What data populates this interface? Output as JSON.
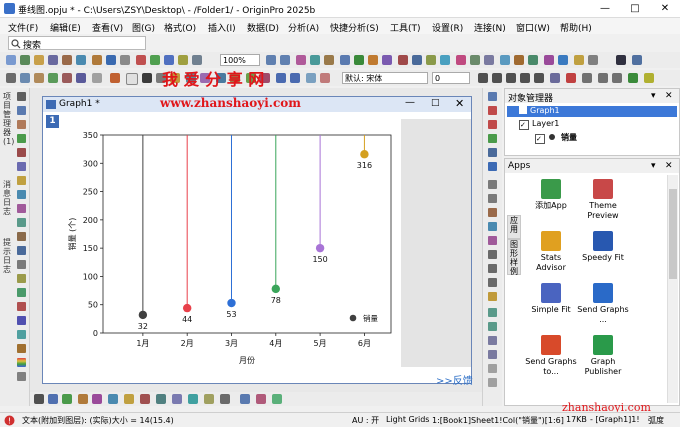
{
  "window": {
    "title": "垂线图.opju * - C:\\Users\\ZSY\\Desktop\\ - /Folder1/ - OriginPro 2025b"
  },
  "menu": [
    "文件(F)",
    "编辑(E)",
    "查看(V)",
    "图(G)",
    "格式(O)",
    "插入(I)",
    "数据(D)",
    "分析(A)",
    "快捷分析(S)",
    "工具(T)",
    "设置(R)",
    "连接(N)",
    "窗口(W)",
    "帮助(H)"
  ],
  "search": {
    "label": "搜索"
  },
  "toolbar": {
    "zoom": "100%",
    "font": "默认: 宋体",
    "size": "0"
  },
  "left_sidebar": {
    "tabs": [
      "项目管理器(1)",
      "消息日志",
      "提示日志"
    ]
  },
  "graph_window": {
    "title": "Graph1 *",
    "layer_button": "1",
    "feedback": ">>反馈"
  },
  "watermark": {
    "top": "我 爱 分 享 网",
    "url": "www.zhanshaoyi.com",
    "corner": "zhanshaoyi.com"
  },
  "chart_data": {
    "type": "lollipop",
    "categories": [
      "1月",
      "2月",
      "3月",
      "4月",
      "5月",
      "6月"
    ],
    "values": [
      32,
      44,
      53,
      78,
      150,
      316
    ],
    "colors": [
      "#404040",
      "#e8404a",
      "#2d6fd6",
      "#3aa55a",
      "#a874d6",
      "#d4a020"
    ],
    "xlabel": "月份",
    "ylabel": "销量 (个)",
    "ylim": [
      0,
      350
    ],
    "yticks": [
      0,
      50,
      100,
      150,
      200,
      250,
      300,
      350
    ],
    "legend": {
      "label": "销量",
      "placement": "bottom-right"
    }
  },
  "object_manager": {
    "title": "对象管理器",
    "graph": "Graph1",
    "layer": "Layer1",
    "plot": "销量"
  },
  "apps": {
    "title": "Apps",
    "items": [
      {
        "label": "添加App",
        "color": "#3a9a4a"
      },
      {
        "label": "Theme Preview",
        "color": "#c84848"
      },
      {
        "label": "Stats Advisor",
        "color": "#e0a020"
      },
      {
        "label": "Speedy Fit",
        "color": "#2858b0"
      },
      {
        "label": "Simple Fit",
        "color": "#4a64c0"
      },
      {
        "label": "Send Graphs ...",
        "color": "#2a6ac8"
      },
      {
        "label": "Send Graphs to...",
        "color": "#d84a2a"
      },
      {
        "label": "Graph Publisher",
        "color": "#2a9a4a"
      }
    ],
    "side_tabs": [
      "应用",
      "图形样例"
    ]
  },
  "status": {
    "left": "文本(附加到图层): (实际)大小 = 14(15.4)",
    "au": "AU : 开",
    "grids": "Light Grids",
    "sheet": "1:[Book1]Sheet1!Col(\"销量\")[1:6]",
    "size": "17KB",
    "graph": "- [Graph1]1!",
    "unit": "弧度"
  }
}
